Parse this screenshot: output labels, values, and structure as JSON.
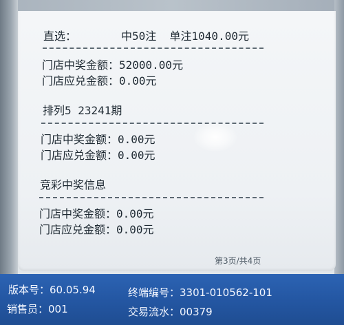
{
  "receipt": {
    "section1": {
      "title": "直选：",
      "summary": "中50注  单注1040.00元",
      "prize_label": "门店中奖金额：52000.00元",
      "redeem_label": "门店应兑金额：0.00元"
    },
    "section2": {
      "title": "排列5 23241期",
      "prize_label": "门店中奖金额：0.00元",
      "redeem_label": "门店应兑金额：0.00元"
    },
    "section3": {
      "title": "竞彩中奖信息",
      "prize_label": "门店中奖金额：0.00元",
      "redeem_label": "门店应兑金额：0.00元"
    },
    "page_indicator": "第3页/共4页"
  },
  "statusbar": {
    "version": "版本号：60.05.94",
    "terminal": "终端编号：3301-010562-101",
    "salesperson": "销售员：001",
    "transaction": "交易流水：00379"
  },
  "colors": {
    "statusbar_bg": "#2457a3",
    "receipt_bg": "#f0f3f6",
    "text": "#1f2a33"
  }
}
